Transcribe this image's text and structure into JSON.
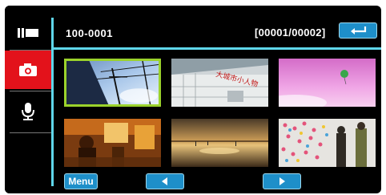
{
  "header": {
    "folder": "100-0001",
    "counter": "[00001/00002]"
  },
  "sidebar": {
    "modes": [
      {
        "icon": "video-mode-icon",
        "active": false
      },
      {
        "icon": "camera-icon",
        "active": true
      },
      {
        "icon": "microphone-icon",
        "active": false
      }
    ]
  },
  "thumbnails": [
    {
      "subject": "power lines against sky",
      "selected": true
    },
    {
      "subject": "building with chinese signage",
      "selected": false,
      "sign_text": "大城市小人物"
    },
    {
      "subject": "pink sky with balloon",
      "selected": false
    },
    {
      "subject": "street market",
      "selected": false
    },
    {
      "subject": "sunset over water",
      "selected": false
    },
    {
      "subject": "heart wall with people",
      "selected": false
    }
  ],
  "footer": {
    "menu_label": "Menu"
  },
  "colors": {
    "accent_line": "#5fd6ea",
    "button_fill": "#1e8fc9",
    "active_mode": "#e3121b",
    "selection_border": "#9bd22b"
  }
}
